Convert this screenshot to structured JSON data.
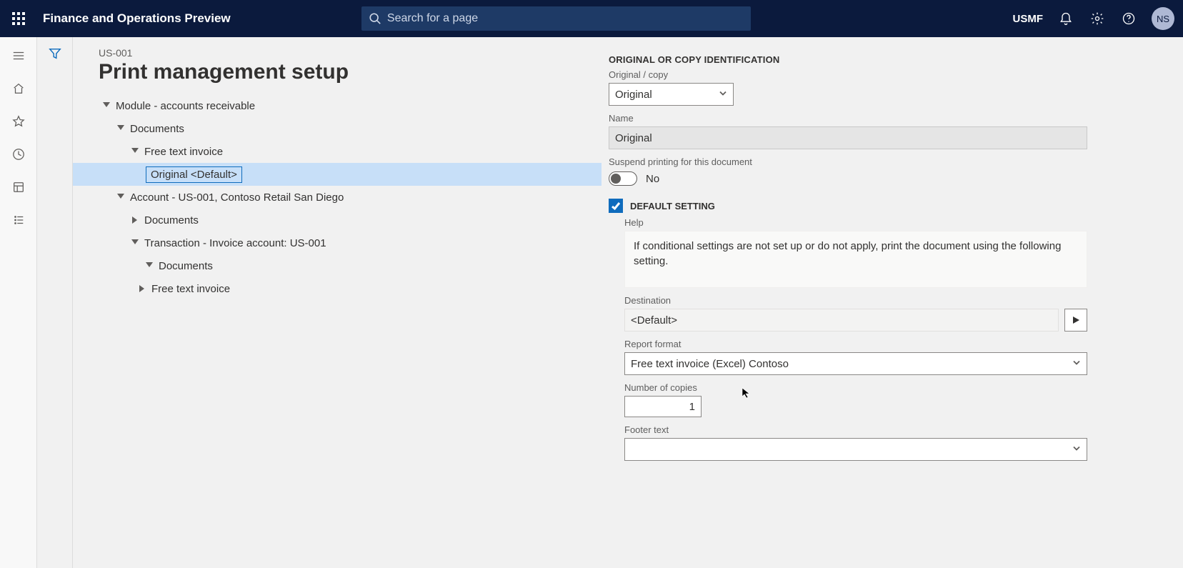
{
  "header": {
    "app_title": "Finance and Operations Preview",
    "search_placeholder": "Search for a page",
    "company": "USMF",
    "avatar_initials": "NS"
  },
  "page": {
    "breadcrumb": "US-001",
    "title": "Print management setup"
  },
  "tree": {
    "module": "Module - accounts receivable",
    "documents": "Documents",
    "free_text_invoice": "Free text invoice",
    "original_default": "Original <Default>",
    "account": "Account - US-001, Contoso Retail San Diego",
    "account_documents": "Documents",
    "transaction": "Transaction - Invoice account: US-001",
    "transaction_documents": "Documents",
    "transaction_free_text": "Free text invoice"
  },
  "form": {
    "section_identification": "ORIGINAL OR COPY IDENTIFICATION",
    "original_copy_label": "Original / copy",
    "original_copy_value": "Original",
    "name_label": "Name",
    "name_value": "Original",
    "suspend_label": "Suspend printing for this document",
    "suspend_value": "No",
    "default_setting_label": "DEFAULT SETTING",
    "help_label": "Help",
    "help_text": "If conditional settings are not set up or do not apply, print the document using the following setting.",
    "destination_label": "Destination",
    "destination_value": "<Default>",
    "report_format_label": "Report format",
    "report_format_value": "Free text invoice (Excel) Contoso",
    "copies_label": "Number of copies",
    "copies_value": "1",
    "footer_label": "Footer text",
    "footer_value": ""
  }
}
